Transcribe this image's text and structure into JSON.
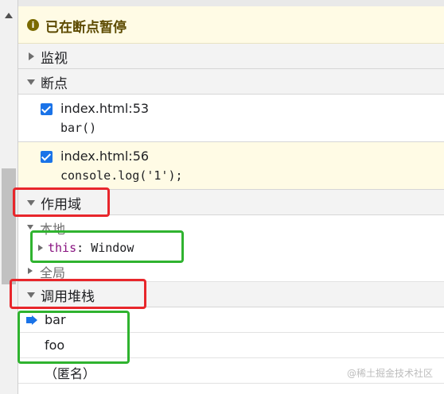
{
  "paused": {
    "icon": "info-icon",
    "icon_glyph": "i",
    "text": "已在断点暂停"
  },
  "sections": {
    "watch": "监视",
    "breakpoints": "断点",
    "scope": "作用域",
    "call_stack": "调用堆栈"
  },
  "breakpoints": [
    {
      "location": "index.html:53",
      "code": "bar()",
      "checked": true,
      "active": false
    },
    {
      "location": "index.html:56",
      "code": "console.log('1');",
      "checked": true,
      "active": true
    }
  ],
  "scope": {
    "local_label": "本地",
    "this_key": "this",
    "this_value": "Window",
    "global_label": "全局"
  },
  "call_stack": {
    "frames": [
      {
        "name": "bar",
        "current": true
      },
      {
        "name": "foo",
        "current": false
      },
      {
        "name": "（匿名）",
        "current": false
      }
    ]
  },
  "watermark": "@稀土掘金技术社区",
  "colors": {
    "paused_banner_bg": "#fffbe5",
    "active_breakpoint_bg": "#fffbe5",
    "checkbox": "#1a73e8",
    "annotation_red": "#e8262b",
    "annotation_green": "#2fb32f",
    "current_frame_arrow": "#1a73e8"
  }
}
